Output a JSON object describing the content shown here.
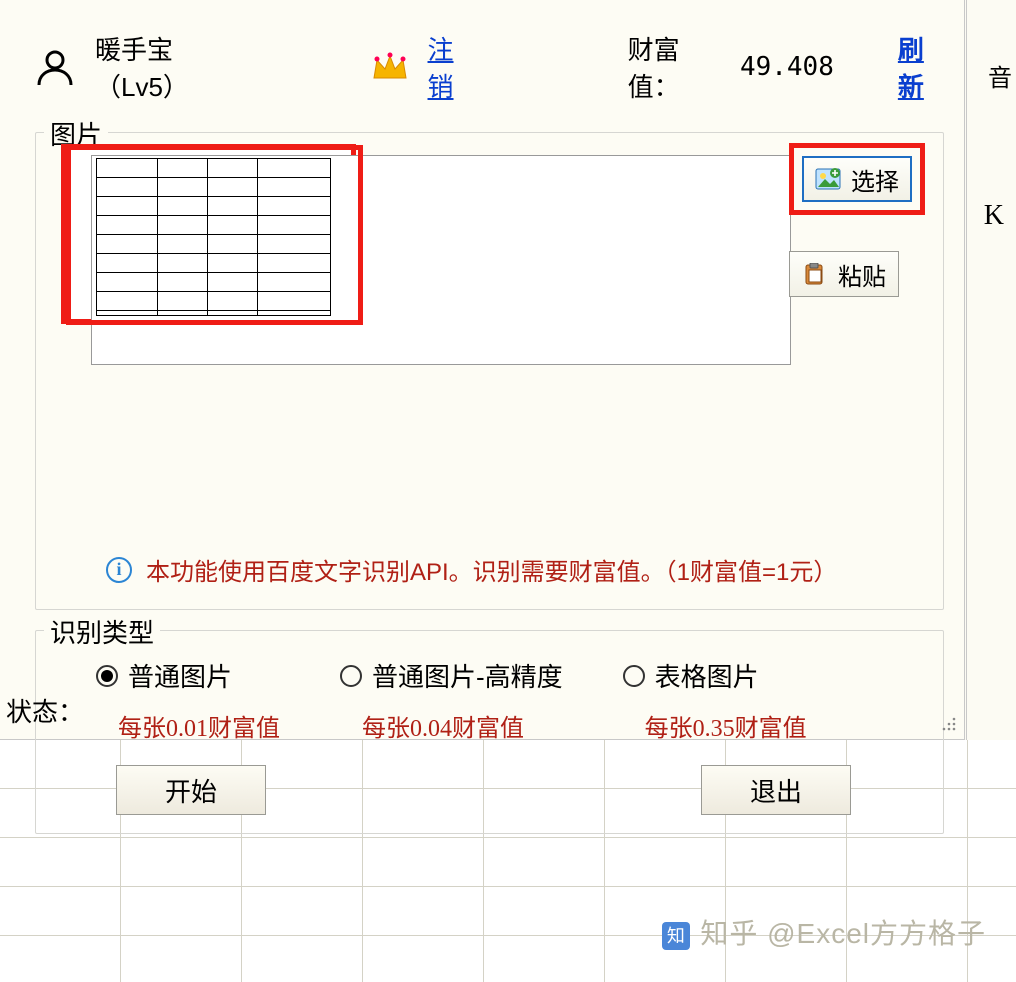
{
  "header": {
    "username": "暖手宝（Lv5）",
    "logout": "注销",
    "wealth_label": "财富值：",
    "wealth_value": "49.408",
    "refresh": "刷新"
  },
  "image_section": {
    "legend": "图片",
    "select_btn": "选择",
    "paste_btn": "粘贴",
    "info_text": "本功能使用百度文字识别API。识别需要财富值。（1财富值=1元）"
  },
  "type_section": {
    "legend": "识别类型",
    "options": [
      {
        "label": "普通图片",
        "sub": "每张0.01财富值",
        "checked": true
      },
      {
        "label": "普通图片-高精度",
        "sub": "每张0.04财富值",
        "checked": false
      },
      {
        "label": "表格图片",
        "sub": "每张0.35财富值",
        "checked": false
      }
    ],
    "start_btn": "开始",
    "exit_btn": "退出"
  },
  "status_label": "状态：",
  "bg": {
    "col_letter": "K",
    "side_text": "音"
  },
  "watermark": "知乎 @Excel方方格子"
}
